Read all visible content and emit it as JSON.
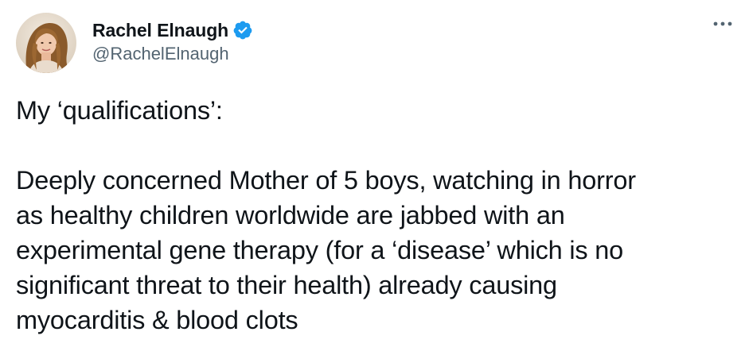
{
  "author": {
    "display_name": "Rachel Elnaugh",
    "handle": "@RachelElnaugh",
    "verified": true,
    "avatar_icon": "profile-photo"
  },
  "tweet": {
    "lines": [
      "My ‘qualifications’:",
      "",
      "Deeply concerned Mother of 5 boys, watching in horror",
      "as healthy children worldwide are jabbed with an",
      "experimental gene therapy (for a ‘disease’ which is no",
      "significant threat to their health) already causing",
      "myocarditis & blood clots"
    ]
  },
  "icons": {
    "verified": "verified-badge-icon",
    "more": "more-options-icon"
  },
  "colors": {
    "verified_blue": "#1d9bf0",
    "text": "#0f1419",
    "secondary": "#536471"
  }
}
